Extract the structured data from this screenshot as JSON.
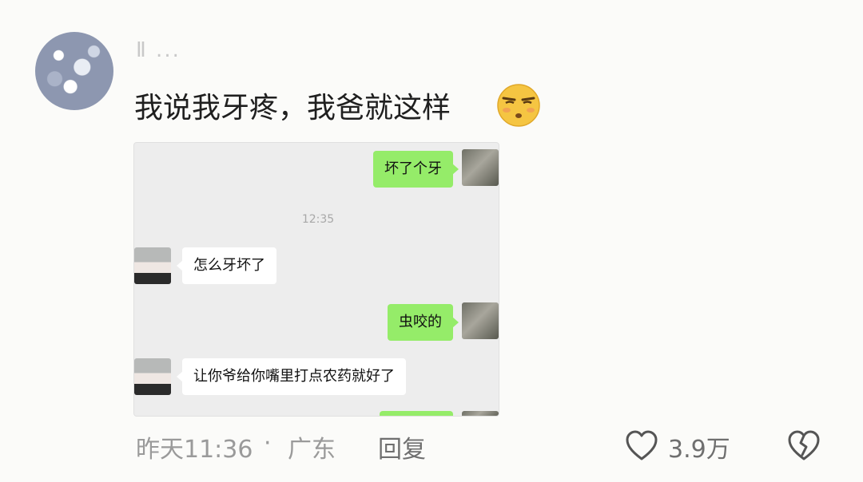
{
  "comment": {
    "username": "Ⅱ ...",
    "text": "我说我牙疼，我爸就这样",
    "emoji_icon": "smirk-face-emoji"
  },
  "chat": {
    "messages": [
      {
        "side": "me",
        "text": "坏了个牙"
      },
      {
        "side": "time",
        "text": "12:35"
      },
      {
        "side": "other",
        "text": "怎么牙坏了"
      },
      {
        "side": "me",
        "text": "虫咬的"
      },
      {
        "side": "other",
        "text": "让你爷给你嘴里打点农药就好了"
      }
    ]
  },
  "footer": {
    "time": "昨天11:36",
    "separator": "·",
    "location": "广东",
    "reply_label": "回复",
    "like_count": "3.9万",
    "like_icon": "heart-outline-icon",
    "dislike_icon": "broken-heart-icon"
  },
  "colors": {
    "my_bubble": "#95ec69",
    "other_bubble": "#ffffff",
    "chat_bg": "#ededed"
  }
}
